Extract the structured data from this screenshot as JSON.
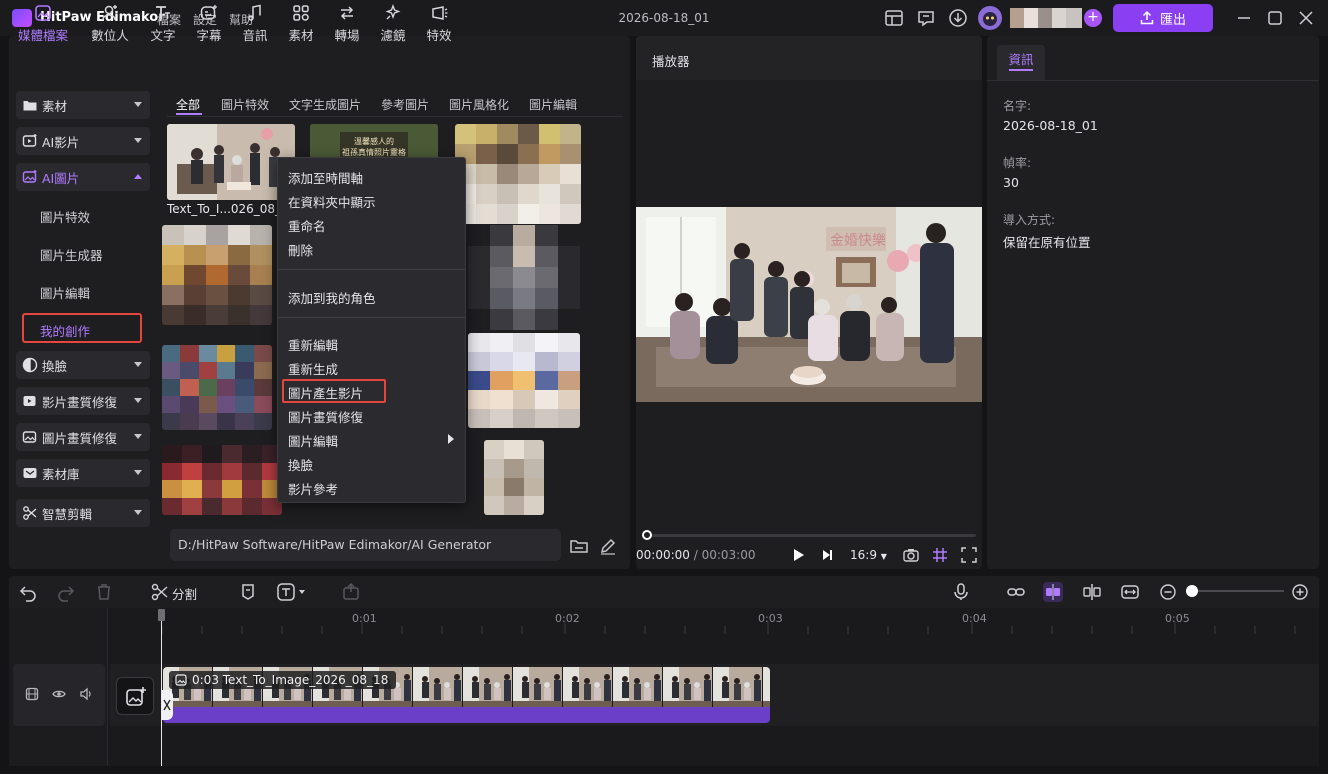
{
  "app": {
    "name": "HitPaw Edimakor",
    "menu": [
      "檔案",
      "設定",
      "幫助"
    ],
    "project_title": "2026-08-18_01",
    "export_label": "匯出"
  },
  "toolbar": {
    "tools": [
      {
        "label": "媒體檔案",
        "icon": "media-icon"
      },
      {
        "label": "數位人",
        "icon": "avatar-add-icon"
      },
      {
        "label": "文字",
        "icon": "text-icon"
      },
      {
        "label": "字幕",
        "icon": "subtitle-icon"
      },
      {
        "label": "音訊",
        "icon": "music-icon"
      },
      {
        "label": "素材",
        "icon": "assets-icon"
      },
      {
        "label": "轉場",
        "icon": "transition-icon"
      },
      {
        "label": "濾鏡",
        "icon": "filter-icon"
      },
      {
        "label": "特效",
        "icon": "effects-icon"
      }
    ]
  },
  "sidebar": {
    "items": [
      {
        "label": "素材"
      },
      {
        "label": "AI影片"
      },
      {
        "label": "AI圖片"
      },
      {
        "label": "換臉"
      },
      {
        "label": "影片畫質修復"
      },
      {
        "label": "圖片畫質修復"
      },
      {
        "label": "素材庫"
      },
      {
        "label": "智慧剪輯"
      }
    ],
    "sub_items": [
      "圖片特效",
      "圖片生成器",
      "圖片編輯",
      "我的創作"
    ]
  },
  "media": {
    "tabs": [
      "全部",
      "圖片特效",
      "文字生成圖片",
      "參考圖片",
      "圖片風格化",
      "圖片編輯"
    ],
    "first_caption": "Text_To_I...026_08_1",
    "poster_text": "溫馨感人的\n祖孫真情照片靈格",
    "path": "D:/HitPaw Software/HitPaw Edimakor/AI Generator"
  },
  "context_menu": {
    "group1": [
      "添加至時間軸",
      "在資料夾中顯示",
      "重命名",
      "刪除"
    ],
    "group2": [
      "添加到我的角色"
    ],
    "group3": [
      "重新編輯",
      "重新生成",
      "圖片產生影片",
      "圖片畫質修復",
      "圖片編輯",
      "換臉",
      "影片參考"
    ]
  },
  "player": {
    "title": "播放器",
    "current_time": "00:00:00",
    "duration": "/ 00:03:00",
    "ratio": "16:9",
    "banner_text": "金婚快樂",
    "progress": 0
  },
  "info": {
    "tab": "資訊",
    "name_label": "名字:",
    "name_value": "2026-08-18_01",
    "fps_label": "幀率:",
    "fps_value": "30",
    "import_label": "導入方式:",
    "import_value": "保留在原有位置"
  },
  "timeline": {
    "split_label": "分割",
    "ticks": [
      "0:01",
      "0:02",
      "0:03",
      "0:04",
      "0:05"
    ],
    "clip_label": "0:03 Text_To_Image_2026_08_18"
  },
  "colors": {
    "accent": "#8b3ff3",
    "accent_text": "#b07bff",
    "highlight_box": "#e4453c",
    "clip_bar": "#6b3fc7"
  }
}
